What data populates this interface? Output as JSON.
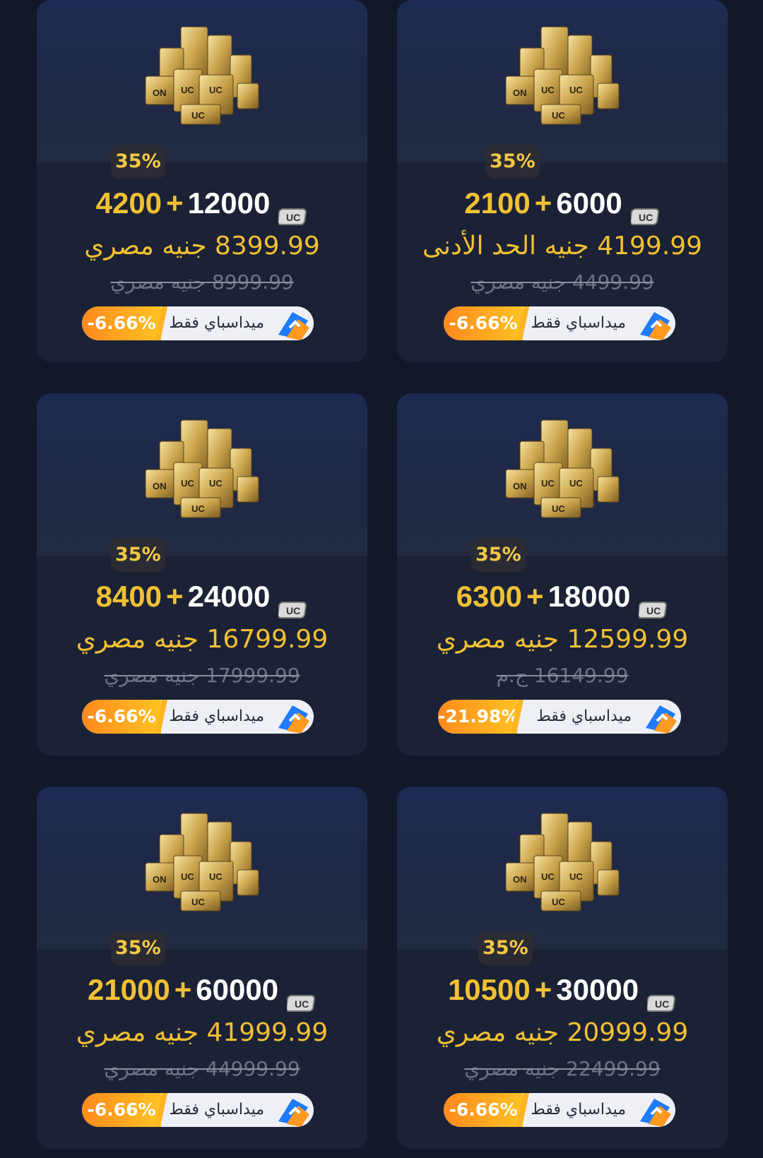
{
  "cards": [
    {
      "bonus_pct": "35%",
      "uc_bonus": "4200",
      "uc_plus": "+",
      "uc_base": "12000",
      "price": "8399.99 جنيه مصري",
      "old_price": "8999.99 جنيه مصري",
      "discount": "-6.66%",
      "pay_label": "ميداسباي فقط"
    },
    {
      "bonus_pct": "35%",
      "uc_bonus": "2100",
      "uc_plus": "+",
      "uc_base": "6000",
      "price": "4199.99 جنيه   الحد الأدنى",
      "old_price": "4499.99 جنيه مصري",
      "discount": "-6.66%",
      "pay_label": "ميداسباي فقط"
    },
    {
      "bonus_pct": "35%",
      "uc_bonus": "8400",
      "uc_plus": "+",
      "uc_base": "24000",
      "price": "16799.99 جنيه مصري",
      "old_price": "17999.99 جنيه مصري",
      "discount": "-6.66%",
      "pay_label": "ميداسباي فقط"
    },
    {
      "bonus_pct": "35%",
      "uc_bonus": "6300",
      "uc_plus": "+",
      "uc_base": "18000",
      "price": "12599.99 جنيه مصري",
      "old_price": "16149.99 ج.م",
      "discount": "-21.98%",
      "pay_label": "ميداسباي فقط"
    },
    {
      "bonus_pct": "35%",
      "uc_bonus": "21000",
      "uc_plus": "+",
      "uc_base": "60000",
      "price": "41999.99 جنيه مصري",
      "old_price": "44999.99 جنيه مصري",
      "discount": "-6.66%",
      "pay_label": "ميداسباي فقط"
    },
    {
      "bonus_pct": "35%",
      "uc_bonus": "10500",
      "uc_plus": "+",
      "uc_base": "30000",
      "price": "20999.99 جنيه مصري",
      "old_price": "22499.99 جنيه مصري",
      "discount": "-6.66%",
      "pay_label": "ميداسباي فقط"
    }
  ],
  "colors": {
    "page_bg": "#121729",
    "card_bg": "#1b2236",
    "gold": "#f2c032",
    "discount_orange": "#ff9a1f"
  },
  "icons": {
    "product": "uc-coin-pile-icon",
    "currency": "uc-icon",
    "payment": "midasbuy-logo-icon"
  }
}
